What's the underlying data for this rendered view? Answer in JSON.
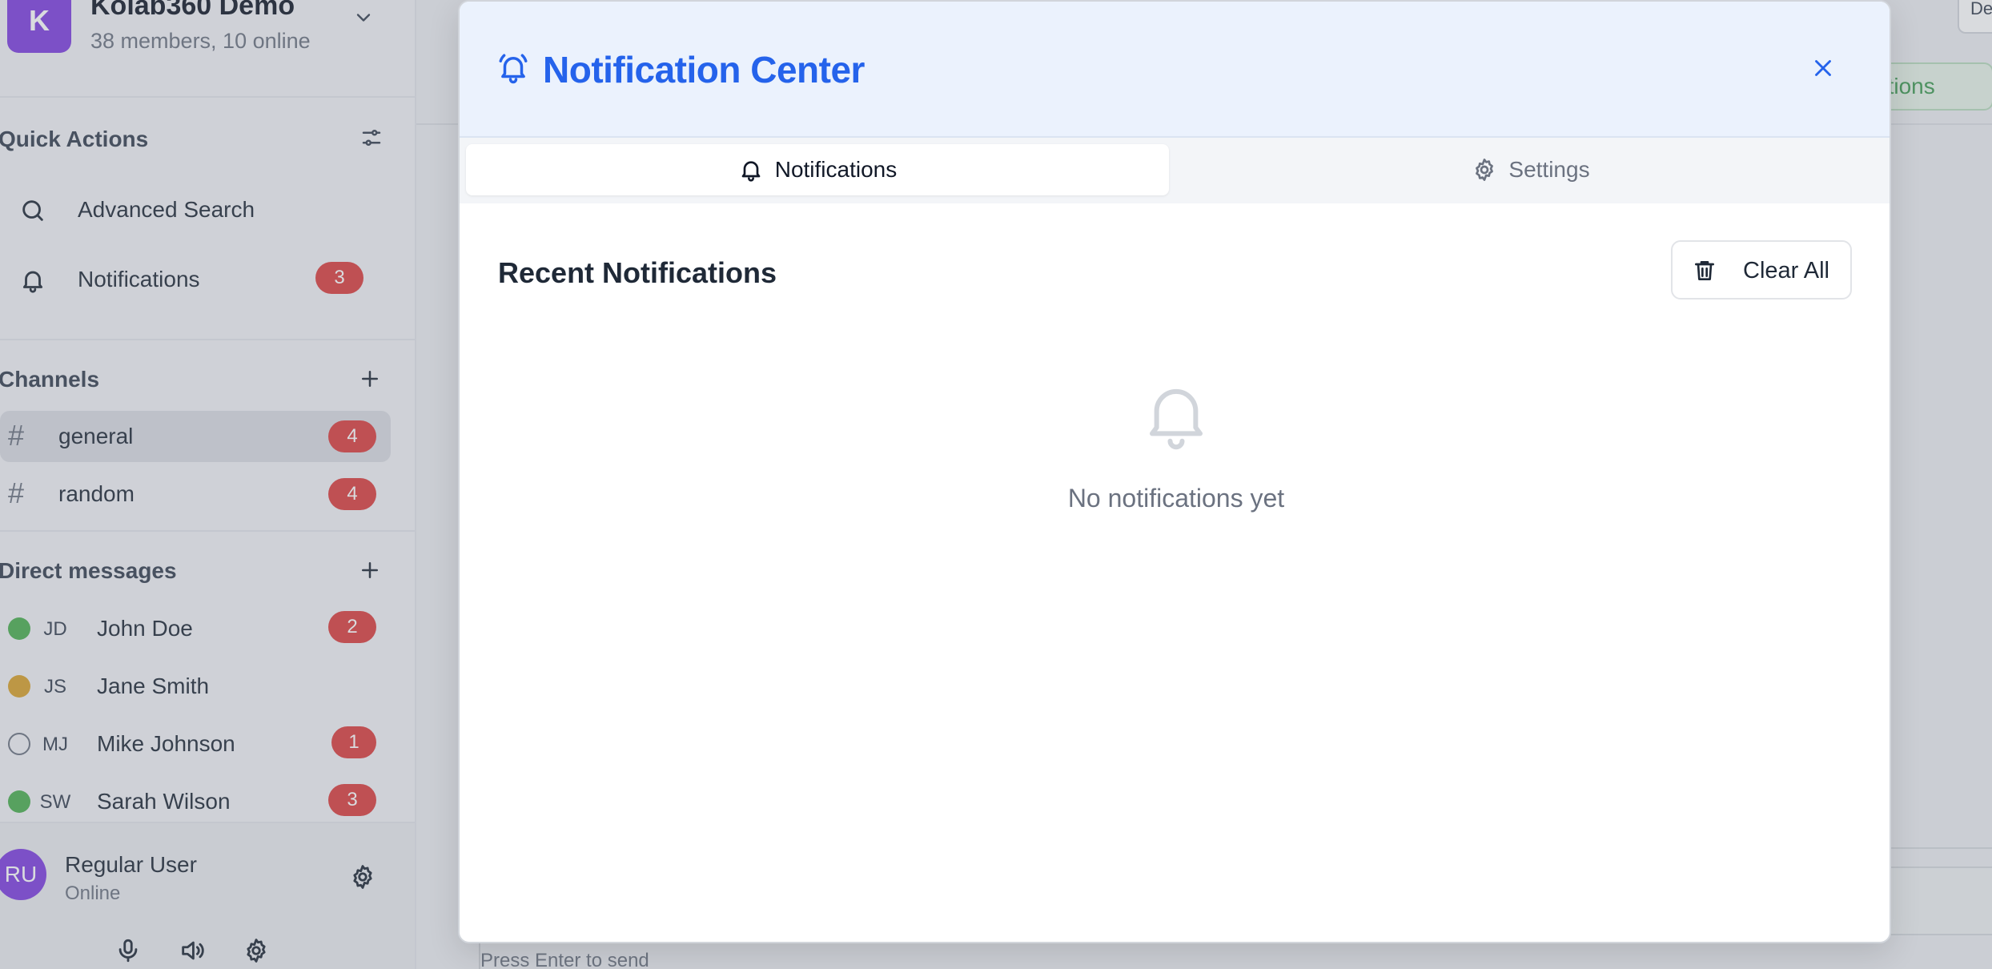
{
  "workspace": {
    "initial": "K",
    "name": "Kolab360 Demo",
    "subtitle": "38 members, 10 online"
  },
  "quick_actions": {
    "title": "Quick Actions",
    "items": [
      {
        "label": "Advanced Search",
        "icon": "search-icon"
      },
      {
        "label": "Notifications",
        "icon": "bell-icon",
        "badge": "3"
      }
    ]
  },
  "channels": {
    "title": "Channels",
    "items": [
      {
        "label": "general",
        "badge": "4",
        "active": true
      },
      {
        "label": "random",
        "badge": "4",
        "active": false
      }
    ]
  },
  "direct_messages": {
    "title": "Direct messages",
    "items": [
      {
        "initials": "JD",
        "name": "John Doe",
        "status": "online",
        "badge": "2"
      },
      {
        "initials": "JS",
        "name": "Jane Smith",
        "status": "away",
        "badge": ""
      },
      {
        "initials": "MJ",
        "name": "Mike Johnson",
        "status": "offline",
        "badge": "1"
      },
      {
        "initials": "SW",
        "name": "Sarah Wilson",
        "status": "online",
        "badge": "3"
      }
    ]
  },
  "user": {
    "initials": "RU",
    "name": "Regular User",
    "status": "Online"
  },
  "background": {
    "button_label": "cations",
    "corner_label": "De",
    "composer_hint": "Press Enter to send"
  },
  "modal": {
    "title": "Notification Center",
    "tabs": [
      {
        "label": "Notifications",
        "icon": "bell-icon",
        "active": true
      },
      {
        "label": "Settings",
        "icon": "gear-icon",
        "active": false
      }
    ],
    "recent_title": "Recent Notifications",
    "clear_label": "Clear All",
    "empty_text": "No notifications yet"
  },
  "colors": {
    "brand": "#7e3fe0",
    "accent": "#2563eb",
    "badge": "#dc3f3f",
    "online": "#4caf50",
    "away": "#d9a12b"
  }
}
